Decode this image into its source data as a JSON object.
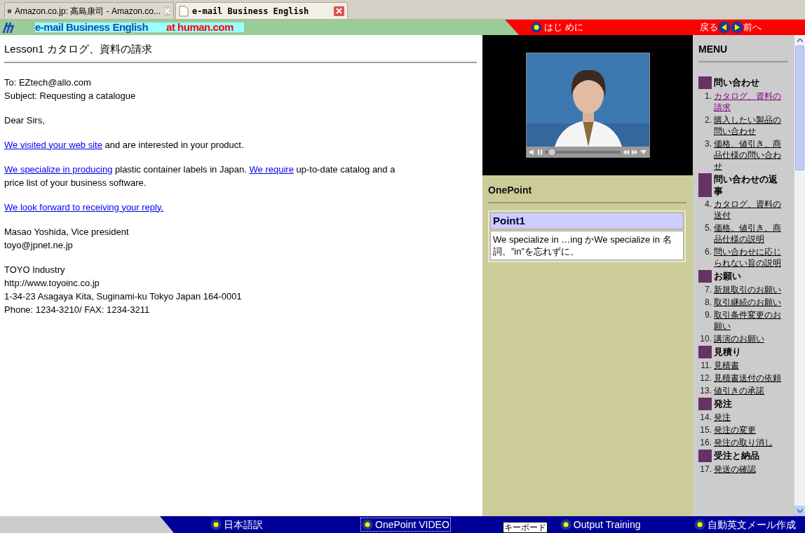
{
  "browser_tabs": [
    {
      "title": "Amazon.co.jp: 高島康司 - Amazon.co...",
      "selected": false,
      "kind": "amazon"
    },
    {
      "title": "e-mail Business English",
      "selected": true,
      "kind": "page"
    }
  ],
  "header": {
    "brand": "e-mail Business English",
    "site": "at human.com",
    "start": "はじ めに",
    "back": "戻る",
    "next": "前へ"
  },
  "lesson": {
    "title": "Lesson1 カタログ、資料の請求",
    "blocks": [
      [
        [
          {
            "text": "To: EZtech@allo.com",
            "link": false
          }
        ],
        [
          {
            "text": "Subject: Requesting a catalogue",
            "link": false
          }
        ]
      ],
      [
        [
          {
            "text": "Dear Sirs,",
            "link": false
          }
        ]
      ],
      [
        [
          {
            "text": "We visited your web site",
            "link": true
          },
          {
            "text": " and are interested in your product.",
            "link": false
          }
        ]
      ],
      [
        [
          {
            "text": "We specialize in producing",
            "link": true
          },
          {
            "text": " plastic container labels in Japan. ",
            "link": false
          },
          {
            "text": "We require",
            "link": true
          },
          {
            "text": " up-to-date catalog and a",
            "link": false
          }
        ],
        [
          {
            "text": "price list of your business software.",
            "link": false
          }
        ]
      ],
      [
        [
          {
            "text": "We look forward to receiving your reply.",
            "link": true
          }
        ]
      ],
      [
        [
          {
            "text": "Masao Yoshida, Vice president",
            "link": false
          }
        ],
        [
          {
            "text": "toyo@jpnet.ne.jp",
            "link": false
          }
        ]
      ],
      [
        [
          {
            "text": "TOYO Industry",
            "link": false
          }
        ],
        [
          {
            "text": "http://www.toyoinc.co.jp",
            "link": false
          }
        ],
        [
          {
            "text": "1-34-23 Asagaya Kita, Suginami-ku Tokyo Japan 164-0001",
            "link": false
          }
        ],
        [
          {
            "text": "Phone: 1234-3210/ FAX: 1234-3211",
            "link": false
          }
        ]
      ]
    ]
  },
  "video": {
    "level": 0.1
  },
  "onepoint": {
    "title": "OnePoint",
    "point_title": "Point1",
    "point_text": "We specialize in …ing かWe specialize in 名詞。”in”を忘れずに。"
  },
  "menu": {
    "title": "MENU",
    "sections": [
      {
        "heading": "問い合わせ",
        "items": [
          {
            "number": "1.",
            "label": "カタログ、資料の請求",
            "visited": true
          },
          {
            "number": "2.",
            "label": "購入したい製品の問い合わせ",
            "visited": false
          },
          {
            "number": "3.",
            "label": "価格、値引き、商品仕様の問い合わせ",
            "visited": false
          }
        ]
      },
      {
        "heading": "問い合わせの返事",
        "items": [
          {
            "number": "4.",
            "label": "カタログ、資料の送付",
            "visited": false
          },
          {
            "number": "5.",
            "label": "価格、値引き、商品仕様の説明",
            "visited": false
          },
          {
            "number": "6.",
            "label": "問い合わせに応じられない旨の説明",
            "visited": false
          }
        ]
      },
      {
        "heading": "お願い",
        "items": [
          {
            "number": "7.",
            "label": "新規取引のお願い",
            "visited": false
          },
          {
            "number": "8.",
            "label": "取引継続のお願い",
            "visited": false
          },
          {
            "number": "9.",
            "label": "取引条件変更のお願い",
            "visited": false
          },
          {
            "number": "10.",
            "label": "講演のお願い",
            "visited": false
          }
        ]
      },
      {
        "heading": "見積り",
        "items": [
          {
            "number": "11.",
            "label": "見積書",
            "visited": false
          },
          {
            "number": "12.",
            "label": "見積書送付の依頼",
            "visited": false
          },
          {
            "number": "13.",
            "label": "値引きの承諾",
            "visited": false
          }
        ]
      },
      {
        "heading": "発注",
        "items": [
          {
            "number": "14.",
            "label": "発注",
            "visited": false
          },
          {
            "number": "15.",
            "label": "発注の変更",
            "visited": false
          },
          {
            "number": "16.",
            "label": "発注の取り消し",
            "visited": false
          }
        ]
      },
      {
        "heading": "受注と納品",
        "items": [
          {
            "number": "17.",
            "label": "発送の確認",
            "visited": false
          }
        ]
      }
    ]
  },
  "bottom_bar": {
    "buttons": [
      {
        "label": "日本語訳",
        "selected": false
      },
      {
        "label": "OnePoint VIDEO",
        "selected": true
      },
      {
        "label": "Output Training",
        "selected": false
      },
      {
        "label": "自動英文メール作成",
        "selected": false
      }
    ],
    "tooltip": "キーボード"
  }
}
